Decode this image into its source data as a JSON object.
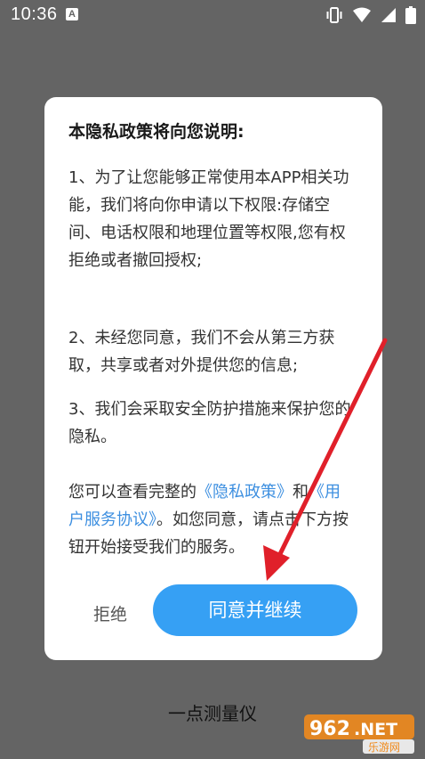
{
  "status_bar": {
    "time": "10:36",
    "notification_letter": "A"
  },
  "dialog": {
    "title": "本隐私政策将向您说明:",
    "item1": "1、为了让您能够正常使用本APP相关功能，我们将向你申请以下权限:存储空间、电话权限和地理位置等权限,您有权拒绝或者撤回授权;",
    "item2": "2、未经您同意，我们不会从第三方获取，共享或者对外提供您的信息;",
    "item3": "3、我们会采取安全防护措施来保护您的隐私。",
    "notice_prefix": "您可以查看完整的",
    "privacy_link": "《隐私政策》",
    "notice_and": "和",
    "agreement_link": "《用户服务协议》",
    "notice_suffix": "。如您同意，请点击下方按钮开始接受我们的服务。",
    "refuse_label": "拒绝",
    "agree_label": "同意并继续"
  },
  "app_name": "一点测量仪",
  "watermark": {
    "number": "962",
    "dot_net": ".NET",
    "site_text": "乐游网"
  },
  "colors": {
    "overlay_bg": "#646464",
    "accent": "#36a0f4",
    "link": "#3d8fe0",
    "arrow": "#e0202a"
  }
}
